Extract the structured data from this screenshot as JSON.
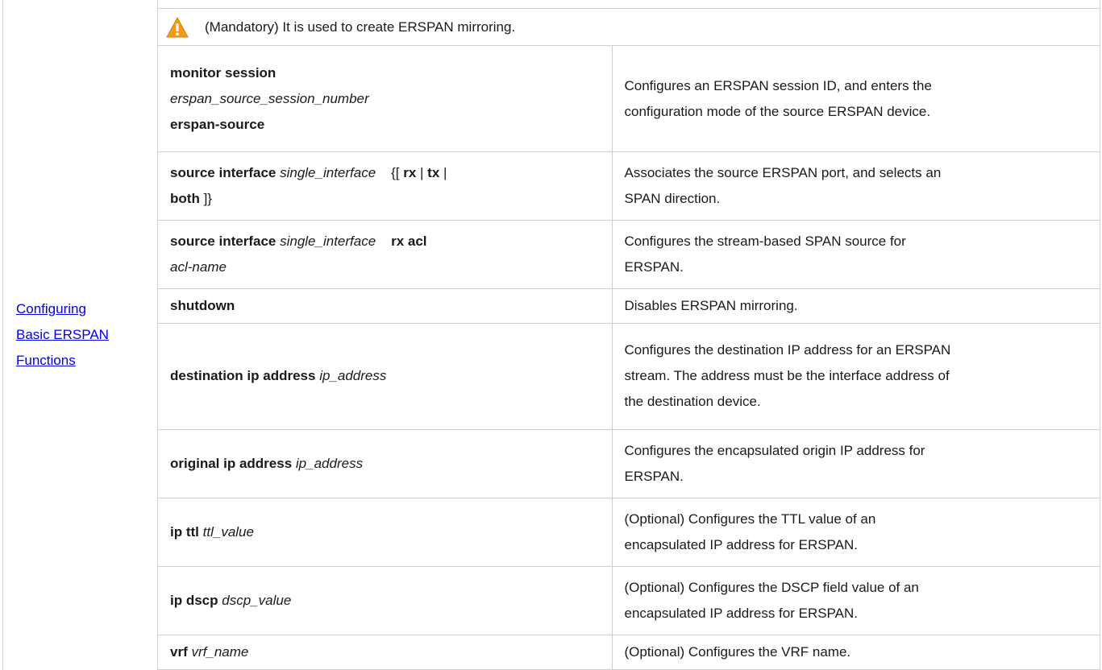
{
  "section": {
    "function_label_lines": [
      "Configuring",
      "Basic ERSPAN",
      "Functions"
    ],
    "note": {
      "icon": "warning-icon",
      "text": "(Mandatory) It is used to create ERSPAN mirroring."
    }
  },
  "commands": [
    {
      "cmd_lines": [
        [
          {
            "t": "monitor session",
            "s": "kw"
          }
        ],
        [
          {
            "t": "erspan_source_session_number",
            "s": "arg"
          }
        ],
        [
          {
            "t": "erspan-source",
            "s": "kw"
          }
        ]
      ],
      "desc_lines": [
        "Configures an ERSPAN session ID, and enters the",
        "configuration mode of the source ERSPAN device."
      ]
    },
    {
      "cmd_lines": [
        [
          {
            "t": "source interface",
            "s": "kw"
          },
          {
            "t": " ",
            "s": "plain"
          },
          {
            "t": "single_interface",
            "s": "arg"
          },
          {
            "t": "    {[ ",
            "s": "plain"
          },
          {
            "t": "rx",
            "s": "kw"
          },
          {
            "t": " | ",
            "s": "plain"
          },
          {
            "t": "tx",
            "s": "kw"
          },
          {
            "t": " |",
            "s": "plain"
          }
        ],
        [
          {
            "t": "both",
            "s": "kw"
          },
          {
            "t": " ]}",
            "s": "plain"
          }
        ]
      ],
      "desc_lines": [
        "Associates the source ERSPAN port, and selects an",
        "SPAN direction."
      ]
    },
    {
      "cmd_lines": [
        [
          {
            "t": "source interface",
            "s": "kw"
          },
          {
            "t": " ",
            "s": "plain"
          },
          {
            "t": "single_interface",
            "s": "arg"
          },
          {
            "t": "    ",
            "s": "plain"
          },
          {
            "t": "rx acl",
            "s": "kw"
          }
        ],
        [
          {
            "t": "acl-name",
            "s": "arg"
          }
        ]
      ],
      "desc_lines": [
        "Configures the stream-based SPAN source for",
        "ERSPAN."
      ]
    },
    {
      "cmd_lines": [
        [
          {
            "t": "shutdown",
            "s": "kw"
          }
        ]
      ],
      "desc_lines": [
        "Disables ERSPAN mirroring."
      ]
    },
    {
      "cmd_lines": [
        [
          {
            "t": "destination ip address",
            "s": "kw"
          },
          {
            "t": " ",
            "s": "plain"
          },
          {
            "t": "ip_address",
            "s": "arg"
          }
        ]
      ],
      "desc_lines": [
        "Configures the destination IP address for an ERSPAN",
        "stream. The address must be the interface address of",
        "the destination device."
      ]
    },
    {
      "cmd_lines": [
        [
          {
            "t": "original ip address",
            "s": "kw"
          },
          {
            "t": " ",
            "s": "plain"
          },
          {
            "t": "ip_address",
            "s": "arg"
          }
        ]
      ],
      "desc_lines": [
        "Configures the encapsulated origin IP address for",
        "ERSPAN."
      ]
    },
    {
      "cmd_lines": [
        [
          {
            "t": "ip ttl",
            "s": "kw"
          },
          {
            "t": " ",
            "s": "plain"
          },
          {
            "t": "ttl_value",
            "s": "arg"
          }
        ]
      ],
      "desc_lines": [
        "(Optional) Configures the TTL value of an",
        "encapsulated IP address for ERSPAN."
      ]
    },
    {
      "cmd_lines": [
        [
          {
            "t": "ip dscp",
            "s": "kw"
          },
          {
            "t": " ",
            "s": "plain"
          },
          {
            "t": "dscp_value",
            "s": "arg"
          }
        ]
      ],
      "desc_lines": [
        "(Optional) Configures the DSCP field value of an",
        "encapsulated IP address for ERSPAN."
      ]
    },
    {
      "cmd_lines": [
        [
          {
            "t": "vrf",
            "s": "kw"
          },
          {
            "t": " ",
            "s": "plain"
          },
          {
            "t": "vrf_name",
            "s": "arg"
          }
        ]
      ],
      "desc_lines": [
        "(Optional) Configures the VRF name."
      ]
    }
  ],
  "colors": {
    "link": "#0000ee",
    "border": "#cfcfcf",
    "warning_fill": "#f39c12",
    "warning_mark": "#ffffff"
  }
}
